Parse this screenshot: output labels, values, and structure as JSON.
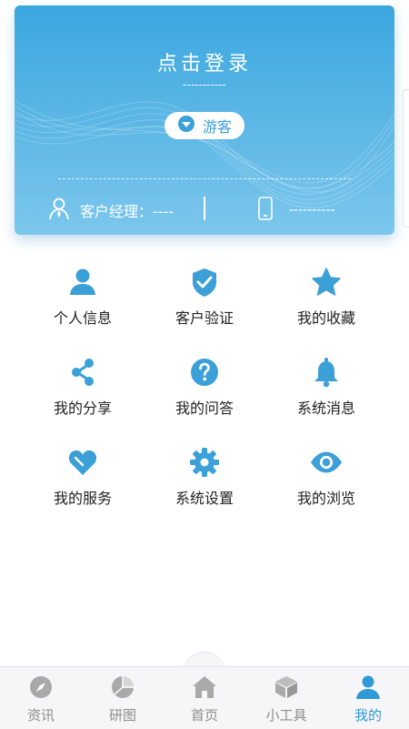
{
  "header": {
    "login_text": "点击登录",
    "login_dashes": "-----------",
    "guest_label": "游客",
    "manager_label": "客户经理：----",
    "phone_value": "----------"
  },
  "menu": [
    {
      "label": "个人信息",
      "icon": "person-icon"
    },
    {
      "label": "客户验证",
      "icon": "shield-check-icon"
    },
    {
      "label": "我的收藏",
      "icon": "star-icon"
    },
    {
      "label": "我的分享",
      "icon": "share-icon"
    },
    {
      "label": "我的问答",
      "icon": "question-icon"
    },
    {
      "label": "系统消息",
      "icon": "bell-icon"
    },
    {
      "label": "我的服务",
      "icon": "heart-icon"
    },
    {
      "label": "系统设置",
      "icon": "gear-icon"
    },
    {
      "label": "我的浏览",
      "icon": "eye-icon"
    }
  ],
  "tabs": [
    {
      "label": "资讯",
      "icon": "compass-icon",
      "active": false
    },
    {
      "label": "研图",
      "icon": "pie-chart-icon",
      "active": false
    },
    {
      "label": "首页",
      "icon": "home-icon",
      "active": false
    },
    {
      "label": "小工具",
      "icon": "box-icon",
      "active": false
    },
    {
      "label": "我的",
      "icon": "user-icon",
      "active": true
    }
  ],
  "colors": {
    "accent": "#3aa7df",
    "icon_blue": "#3b9fd8",
    "tab_inactive": "#8c8c8c",
    "tab_active": "#2e9ad6"
  }
}
